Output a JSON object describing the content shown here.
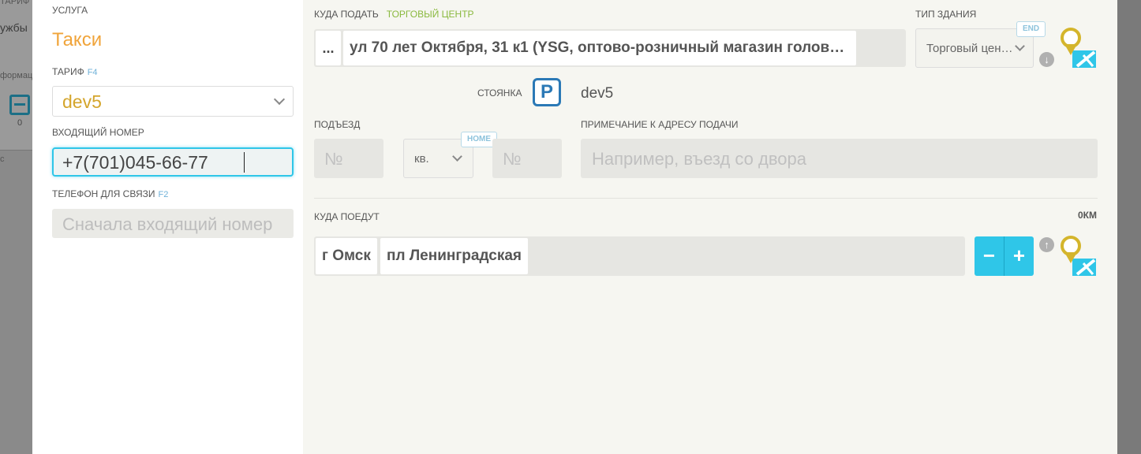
{
  "background": {
    "texts": [
      "ТАРИФ",
      "ужбы",
      "формац",
      "0",
      "с"
    ]
  },
  "left": {
    "service_label": "УСЛУГА",
    "service_value": "Такси",
    "tariff_label": "ТАРИФ",
    "tariff_key": "F4",
    "tariff_value": "dev5",
    "incoming_label": "ВХОДЯЩИЙ НОМЕР",
    "incoming_value": "+7(701)045-66-77",
    "contact_label": "ТЕЛЕФОН ДЛЯ СВЯЗИ",
    "contact_key": "F2",
    "contact_placeholder": "Сначала входящий номер"
  },
  "pickup": {
    "label": "КУДА ПОДАТЬ",
    "type_tag": "ТОРГОВЫЙ ЦЕНТР",
    "dots": "...",
    "address": "ул 70 лет Октября, 31 к1 (YSG, оптово-розничный магазин голов…",
    "building_type_label": "ТИП ЗДАНИЯ",
    "building_type_value": "Торговый цен…",
    "end_key": "END",
    "parking_label": "СТОЯНКА",
    "parking_icon": "P",
    "parking_value": "dev5",
    "entrance_label": "ПОДЪЕЗД",
    "entrance_placeholder": "№",
    "apt_type_value": "кв.",
    "home_key": "HOME",
    "apt_placeholder": "№",
    "note_label": "ПРИМЕЧАНИЕ К АДРЕСУ ПОДАЧИ",
    "note_placeholder": "Например, въезд со двора"
  },
  "destination": {
    "label": "КУДА ПОЕДУТ",
    "distance": "0КМ",
    "chips": [
      "г Омск",
      "пл Ленинградская"
    ],
    "minus": "−",
    "plus": "+"
  },
  "colors": {
    "accent_cyan": "#2fc6e8",
    "service_orange": "#f0a43a",
    "tariff_gold": "#d4a52c",
    "tag_green": "#8ab93f",
    "parking_blue": "#2b79b6",
    "pin_yellow": "#d4b52c"
  },
  "icons": {
    "parking": "parking-icon",
    "map": "map-pin-icon",
    "arrow_down": "arrow-down-circle-icon",
    "arrow_up": "arrow-up-circle-icon"
  }
}
